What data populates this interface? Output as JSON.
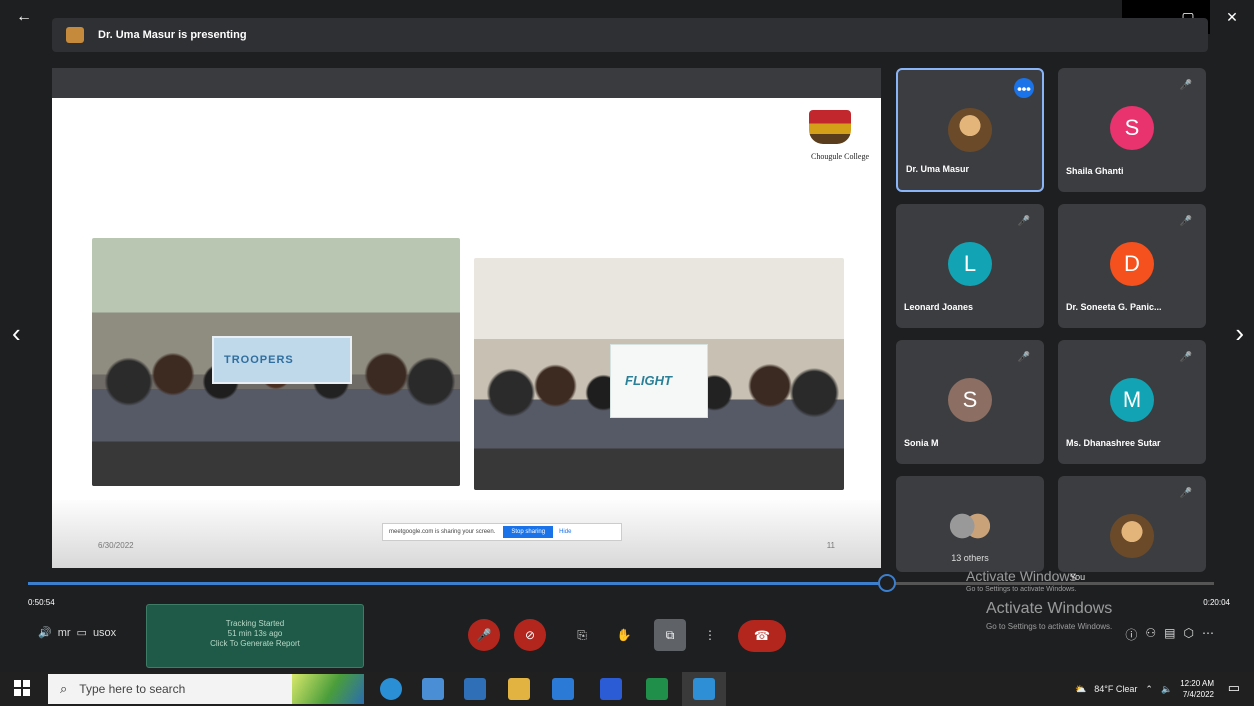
{
  "window": {
    "back_icon": "arrow-left-icon",
    "minimize": "–",
    "maximize": "▢",
    "close": "✕"
  },
  "presenter_bar": {
    "text": "Dr. Uma Masur is presenting"
  },
  "slide": {
    "college_name": "Chougule College",
    "banner_left_text": "TROOPERS",
    "banner_right_text": "FLIGHT",
    "date": "6/30/2022",
    "page_number": "11",
    "share_notice": "meetgoogle.com is sharing your screen.",
    "stop_sharing": "Stop sharing",
    "hide": "Hide"
  },
  "participants": [
    {
      "name": "Dr. Uma Masur",
      "initial": "",
      "color": "",
      "photo": true,
      "active": true
    },
    {
      "name": "Shaila Ghanti",
      "initial": "S",
      "color": "#e8336e"
    },
    {
      "name": "Leonard Joanes",
      "initial": "L",
      "color": "#12a4b4"
    },
    {
      "name": "Dr. Soneeta G. Panic...",
      "initial": "D",
      "color": "#f4511e"
    },
    {
      "name": "Sonia M",
      "initial": "S",
      "color": "#8d6e63"
    },
    {
      "name": "Ms. Dhanashree Sutar",
      "initial": "M",
      "color": "#12a4b4"
    },
    {
      "name": "13 others",
      "initial": "",
      "color": "",
      "others": true
    },
    {
      "name": "",
      "initial": "",
      "color": "",
      "photo": true
    }
  ],
  "you_label": "You",
  "progress": {
    "elapsed": "0:50:54",
    "total": "0:20:04",
    "fraction": 0.8
  },
  "tracking": {
    "line1": "Tracking Started",
    "line2": "51 min 13s ago",
    "line3": "Click To Generate Report"
  },
  "left_controls": {
    "volume": "🔊",
    "label1": "mr",
    "label2": "usox"
  },
  "activate_windows": {
    "title": "Activate Windows",
    "subtitle": "Go to Settings to activate Windows."
  },
  "taskbar": {
    "search_placeholder": "Type here to search",
    "weather": "84°F  Clear",
    "time": "12:20 AM",
    "date": "7/4/2022"
  },
  "colors": {
    "accent": "#1a73e8",
    "tile_bg": "#3c3d40",
    "end_call": "#b3261e",
    "tracking_bg": "#1e5a47"
  }
}
